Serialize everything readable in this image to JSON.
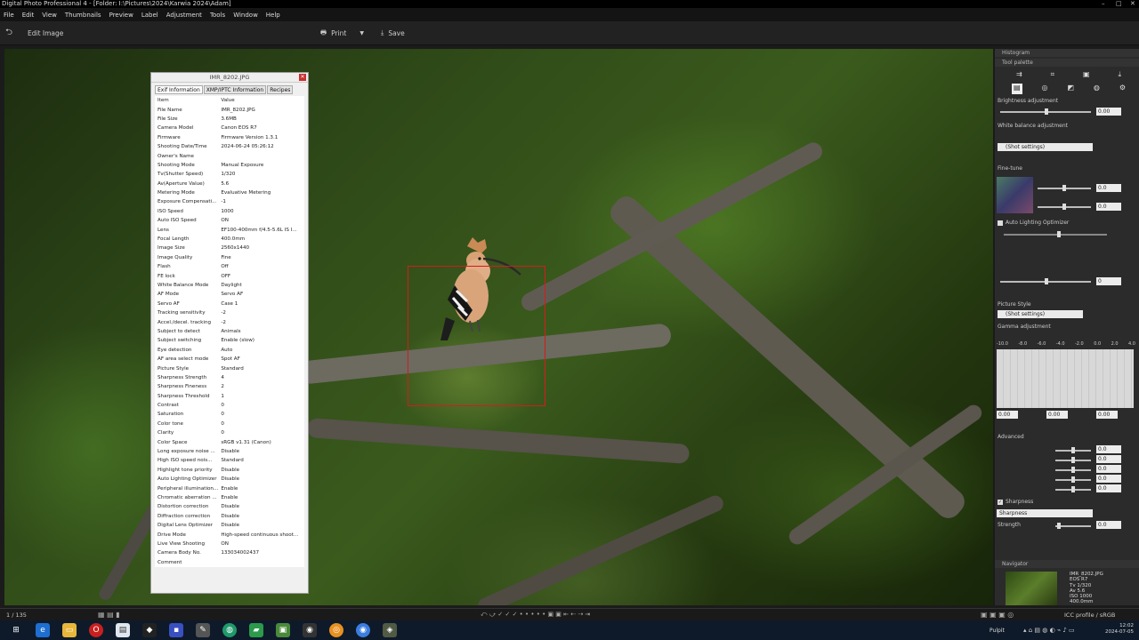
{
  "window": {
    "title": "Digital Photo Professional 4 - [Folder: I:\\Pictures\\2024\\Karwia 2024\\Adam]"
  },
  "menu": [
    "File",
    "Edit",
    "View",
    "Thumbnails",
    "Preview",
    "Label",
    "Adjustment",
    "Tools",
    "Window",
    "Help"
  ],
  "toolbar": {
    "edit_image_label": "Edit Image",
    "print_label": "Print",
    "save_label": "Save"
  },
  "info_dialog": {
    "title": "IMR_8202.JPG",
    "tabs": [
      "Exif Information",
      "XMP/IPTC Information",
      "Recipes"
    ],
    "header": {
      "item": "Item",
      "value": "Value"
    },
    "rows": [
      [
        "File Name",
        "IMR_8202.JPG"
      ],
      [
        "File Size",
        "3.6MB"
      ],
      [
        "Camera Model",
        "Canon EOS R7"
      ],
      [
        "Firmware",
        "Firmware Version 1.3.1"
      ],
      [
        "Shooting Date/Time",
        "2024-06-24 05:26:12"
      ],
      [
        "Owner's Name",
        ""
      ],
      [
        "Shooting Mode",
        "Manual Exposure"
      ],
      [
        "Tv(Shutter Speed)",
        "1/320"
      ],
      [
        "Av(Aperture Value)",
        "5.6"
      ],
      [
        "Metering Mode",
        "Evaluative Metering"
      ],
      [
        "Exposure Compensati...",
        "-1"
      ],
      [
        "ISO Speed",
        "1000"
      ],
      [
        "Auto ISO Speed",
        "ON"
      ],
      [
        "Lens",
        "EF100-400mm f/4.5-5.6L IS I..."
      ],
      [
        "Focal Length",
        "400.0mm"
      ],
      [
        "Image Size",
        "2560x1440"
      ],
      [
        "Image Quality",
        "Fine"
      ],
      [
        "Flash",
        "Off"
      ],
      [
        "FE lock",
        "OFF"
      ],
      [
        "White Balance Mode",
        "Daylight"
      ],
      [
        "AF Mode",
        "Servo AF"
      ],
      [
        "Servo AF",
        "Case 1"
      ],
      [
        "Tracking sensitivity",
        "-2"
      ],
      [
        "Accel./decel. tracking",
        "-2"
      ],
      [
        "Subject to detect",
        "Animals"
      ],
      [
        "Subject switching",
        "Enable (slow)"
      ],
      [
        "Eye detection",
        "Auto"
      ],
      [
        "AF area select mode",
        "Spot AF"
      ],
      [
        "Picture Style",
        "Standard"
      ],
      [
        "Sharpness Strength",
        "4"
      ],
      [
        "Sharpness Fineness",
        "2"
      ],
      [
        "Sharpness Threshold",
        "1"
      ],
      [
        "Contrast",
        "0"
      ],
      [
        "Saturation",
        "0"
      ],
      [
        "Color tone",
        "0"
      ],
      [
        "Clarity",
        "0"
      ],
      [
        "Color Space",
        "sRGB v1.31 (Canon)"
      ],
      [
        "Long exposure noise ...",
        "Disable"
      ],
      [
        "High ISO speed nois...",
        "Standard"
      ],
      [
        "Highlight tone priority",
        "Disable"
      ],
      [
        "Auto Lighting Optimizer",
        "Disable"
      ],
      [
        "Peripheral illumination...",
        "Enable"
      ],
      [
        "Chromatic aberration ...",
        "Enable"
      ],
      [
        "Distortion correction",
        "Disable"
      ],
      [
        "Diffraction correction",
        "Disable"
      ],
      [
        "Digital Lens Optimizer",
        "Disable"
      ],
      [
        "Drive Mode",
        "High-speed continuous shoot..."
      ],
      [
        "Live View Shooting",
        "ON"
      ],
      [
        "Camera Body No.",
        "133034002437"
      ],
      [
        "Comment",
        ""
      ]
    ]
  },
  "panel": {
    "histogram_label": "Histogram",
    "tool_palette_label": "Tool palette",
    "brightness_label": "Brightness adjustment",
    "brightness_value": "0.00",
    "white_balance_label": "White balance adjustment",
    "wb_setting": "(Shot settings)",
    "fine_tune_label": "Fine-tune",
    "fine_tune_value_1": "0.0",
    "fine_tune_value_2": "0.0",
    "alo_label": "Auto Lighting Optimizer",
    "clarity_value": "0",
    "picture_style_label": "Picture Style",
    "ps_setting": "(Shot settings)",
    "gamma_label": "Gamma adjustment",
    "gamma_scale": [
      "-10.0",
      "-8.0",
      "-6.0",
      "-4.0",
      "-2.0",
      "0.0",
      "2.0",
      "4.0"
    ],
    "gamma_values": [
      "0.00",
      "0.00",
      "0.00"
    ],
    "advanced_label": "Advanced",
    "advanced_values": [
      "0.0",
      "0.0",
      "0.0",
      "0.0",
      "0.0"
    ],
    "sharpness_label": "Sharpness",
    "sharpness_setting": "Sharpness",
    "strength_label": "Strength",
    "strength_value": "0.0",
    "navigator_label": "Navigator",
    "nav_info": [
      "IMR_8202.JPG",
      "EOS R7",
      "Tv 1/320",
      "Av 5.6",
      "ISO 1000",
      "400.0mm"
    ]
  },
  "status": {
    "counter": "1 / 135",
    "icc": "ICC profile / sRGB"
  },
  "taskbar": {
    "tray_label": "Pulpit",
    "time": "12:02",
    "date": "2024-07-05"
  }
}
